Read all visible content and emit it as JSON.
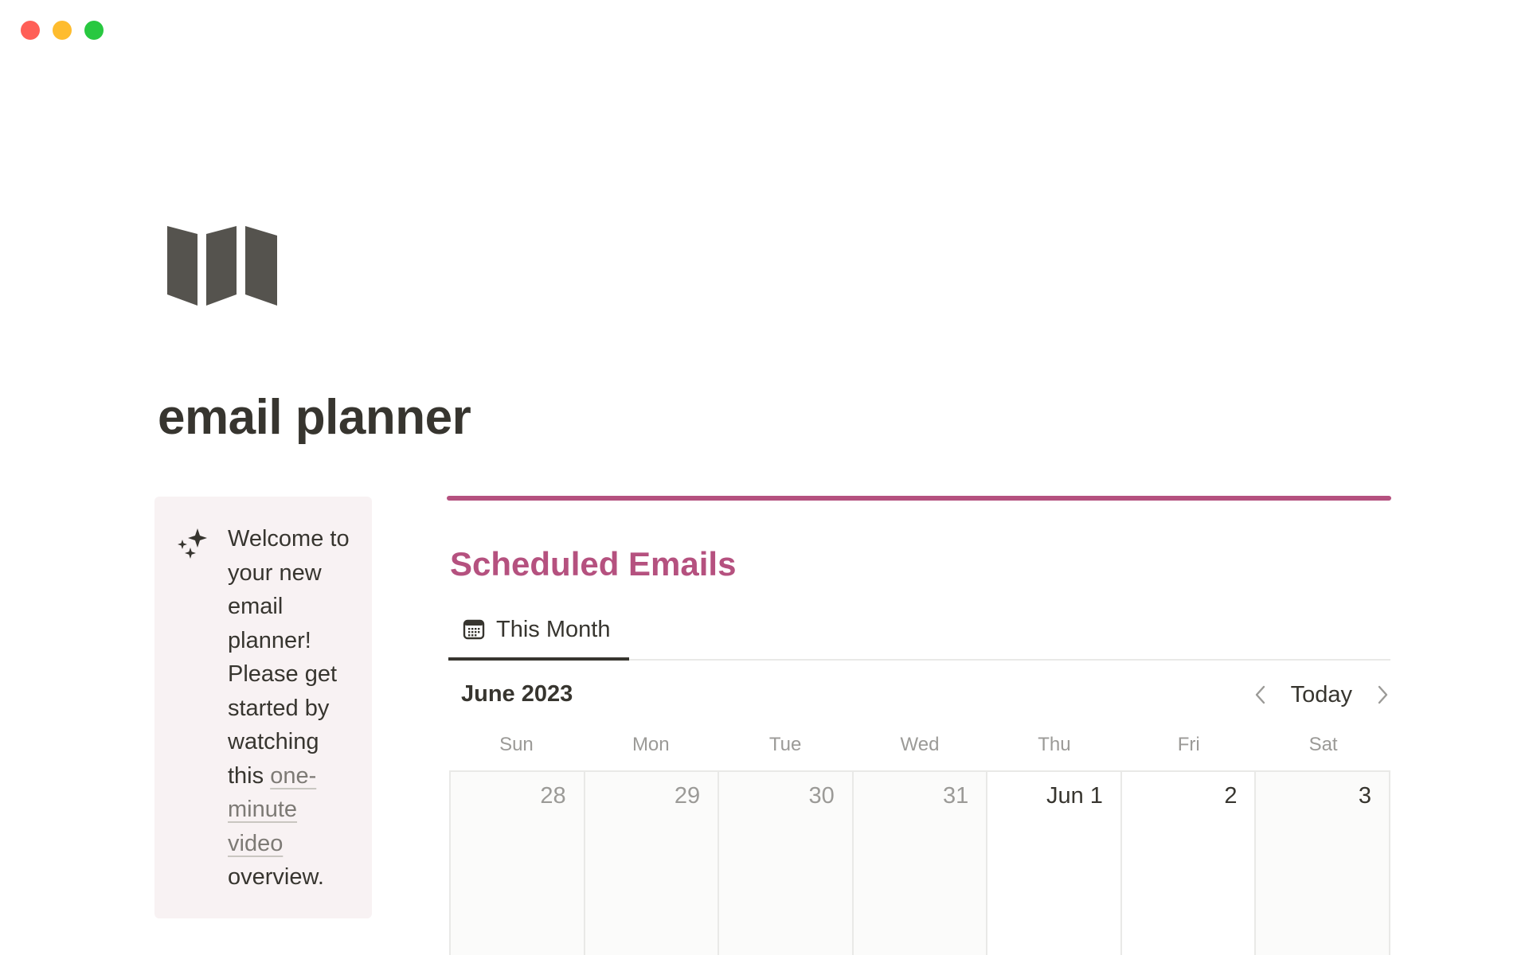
{
  "window": {
    "controls": [
      {
        "name": "close",
        "color": "#ff5f57"
      },
      {
        "name": "minimize",
        "color": "#febc2e"
      },
      {
        "name": "maximize",
        "color": "#28c840"
      }
    ]
  },
  "page": {
    "icon": "map-icon",
    "title": "email planner"
  },
  "callout": {
    "icon": "sparkles-icon",
    "text_before": "Welcome to your new email planner! Please get started by watching this ",
    "link_text": "one-minute video",
    "text_after": " overview."
  },
  "section": {
    "accent_color": "#b5517f",
    "title": "Scheduled Emails"
  },
  "view": {
    "tab_icon": "calendar-icon",
    "tab_label": "This Month"
  },
  "calendar": {
    "month_label": "June 2023",
    "today_label": "Today",
    "weekdays": [
      "Sun",
      "Mon",
      "Tue",
      "Wed",
      "Thu",
      "Fri",
      "Sat"
    ],
    "days": [
      "28",
      "29",
      "30",
      "31",
      "Jun 1",
      "2",
      "3"
    ]
  }
}
